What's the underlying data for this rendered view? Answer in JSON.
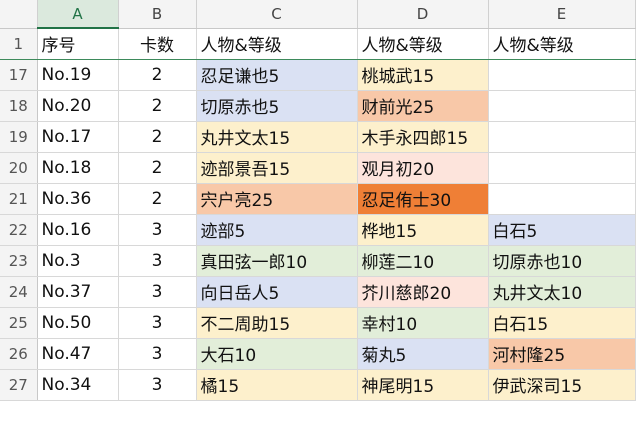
{
  "columns": [
    "A",
    "B",
    "C",
    "D",
    "E"
  ],
  "header_row": {
    "num": "1",
    "a": "序号",
    "b": "卡数",
    "c": "人物&等级",
    "d": "人物&等级",
    "e": "人物&等级"
  },
  "rows": [
    {
      "num": "17",
      "a": "No.19",
      "b": "2",
      "c": "忍足谦也5",
      "d": "桃城武15",
      "e": "",
      "cc": "#dae1f3",
      "dc": "#fdf0cc",
      "ec": "#ffffff"
    },
    {
      "num": "18",
      "a": "No.20",
      "b": "2",
      "c": "切原赤也5",
      "d": "财前光25",
      "e": "",
      "cc": "#dae1f3",
      "dc": "#f8c8a8",
      "ec": "#ffffff"
    },
    {
      "num": "19",
      "a": "No.17",
      "b": "2",
      "c": "丸井文太15",
      "d": "木手永四郎15",
      "e": "",
      "cc": "#fdf0cc",
      "dc": "#fdf0cc",
      "ec": "#ffffff"
    },
    {
      "num": "20",
      "a": "No.18",
      "b": "2",
      "c": "迹部景吾15",
      "d": "观月初20",
      "e": "",
      "cc": "#fdf0cc",
      "dc": "#fde4dc",
      "ec": "#ffffff"
    },
    {
      "num": "21",
      "a": "No.36",
      "b": "2",
      "c": "宍户亮25",
      "d": "忍足侑士30",
      "e": "",
      "cc": "#f8c8a8",
      "dc": "#ef7f36",
      "ec": "#ffffff"
    },
    {
      "num": "22",
      "a": "No.16",
      "b": "3",
      "c": "迹部5",
      "d": "桦地15",
      "e": "白石5",
      "cc": "#dae1f3",
      "dc": "#fdf0cc",
      "ec": "#dae1f3"
    },
    {
      "num": "23",
      "a": "No.3",
      "b": "3",
      "c": "真田弦一郎10",
      "d": "柳莲二10",
      "e": "切原赤也10",
      "cc": "#e2eed9",
      "dc": "#e2eed9",
      "ec": "#e2eed9"
    },
    {
      "num": "24",
      "a": "No.37",
      "b": "3",
      "c": "向日岳人5",
      "d": "芥川慈郎20",
      "e": "丸井文太10",
      "cc": "#dae1f3",
      "dc": "#fde4dc",
      "ec": "#e2eed9"
    },
    {
      "num": "25",
      "a": "No.50",
      "b": "3",
      "c": "不二周助15",
      "d": "幸村10",
      "e": "白石15",
      "cc": "#fdf0cc",
      "dc": "#e2eed9",
      "ec": "#fdf0cc"
    },
    {
      "num": "26",
      "a": "No.47",
      "b": "3",
      "c": "大石10",
      "d": "菊丸5",
      "e": "河村隆25",
      "cc": "#e2eed9",
      "dc": "#dae1f3",
      "ec": "#f8c8a8"
    },
    {
      "num": "27",
      "a": "No.34",
      "b": "3",
      "c": "橘15",
      "d": "神尾明15",
      "e": "伊武深司15",
      "cc": "#fdf0cc",
      "dc": "#fdf0cc",
      "ec": "#fdf0cc"
    }
  ]
}
